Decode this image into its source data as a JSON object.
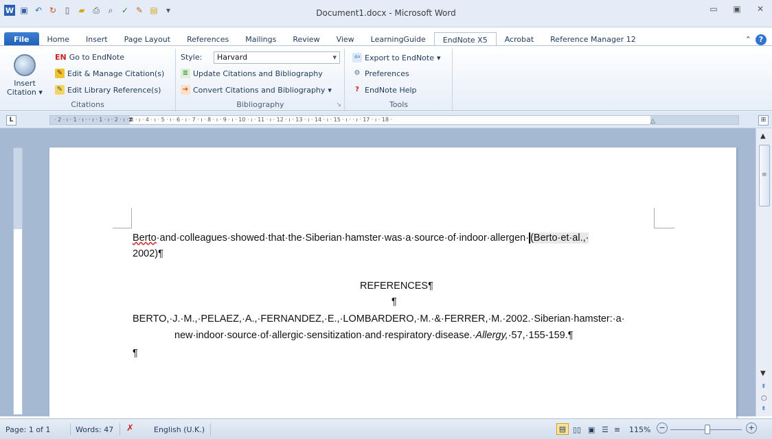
{
  "window": {
    "title": "Document1.docx  -  Microsoft Word",
    "controls": [
      "▭",
      "▣",
      "✕"
    ]
  },
  "qat_icons": [
    "word-icon",
    "save-icon",
    "undo-icon",
    "redo-icon",
    "new-icon",
    "open-icon",
    "print-icon",
    "print-preview-icon",
    "spelling-icon",
    "draw-icon",
    "folder-icon",
    "customize-icon"
  ],
  "tabs": [
    "File",
    "Home",
    "Insert",
    "Page Layout",
    "References",
    "Mailings",
    "Review",
    "View",
    "LearningGuide",
    "EndNote X5",
    "Acrobat",
    "Reference Manager 12"
  ],
  "active_tab": "EndNote X5",
  "ribbon": {
    "citations": {
      "label": "Citations",
      "insert_citation": "Insert",
      "insert_citation_2": "Citation",
      "go_to_endnote": "Go to EndNote",
      "en_mark": "EN",
      "edit_manage": "Edit & Manage Citation(s)",
      "edit_library": "Edit Library Reference(s)"
    },
    "bibliography": {
      "label": "Bibliography",
      "style_label": "Style:",
      "style_value": "Harvard",
      "update": "Update Citations and Bibliography",
      "convert": "Convert Citations and Bibliography"
    },
    "tools": {
      "label": "Tools",
      "export": "Export to EndNote",
      "preferences": "Preferences",
      "help": "EndNote Help"
    }
  },
  "ruler_text": "· 2 · ı · 1 · ı ·   · ı · 1 · ı · 2 · ı · 3 · ı · 4 · ı · 5 · ı · 6 · ı · 7 · ı · 8 · ı · 9 · ı · 10 · ı · 11 · ı · 12 · ı · 13 · ı · 14 · ı · 15 · ı ·   · ı · 17 · ı · 18 ·",
  "document": {
    "para1_line1_a": "Berto",
    "para1_line1_b": "·and·colleagues·showed·that·the·Siberian·hamster·was·a·source·of·indoor·allergen·",
    "para1_line1_c": "(Berto·et·al.,·",
    "para1_line2": "2002)¶",
    "heading": "REFERENCES¶",
    "empty_para": "¶",
    "ref_line1": "BERTO,·J.·M.,·PELAEZ,·A.,·FERNANDEZ,·E.,·LOMBARDERO,·M.·&·FERRER,·M.·2002.·Siberian·hamster:·a·",
    "ref_line2_a": "new·indoor·source·of·allergic·sensitization·and·respiratory·disease.·",
    "ref_line2_journal": "Allergy,",
    "ref_line2_b": "·57,·155-159.¶",
    "trailing_para": "¶"
  },
  "status": {
    "page": "Page: 1 of 1",
    "words": "Words: 47",
    "language": "English (U.K.)",
    "zoom": "115%",
    "zoom_minus": "−",
    "zoom_plus": "+"
  }
}
